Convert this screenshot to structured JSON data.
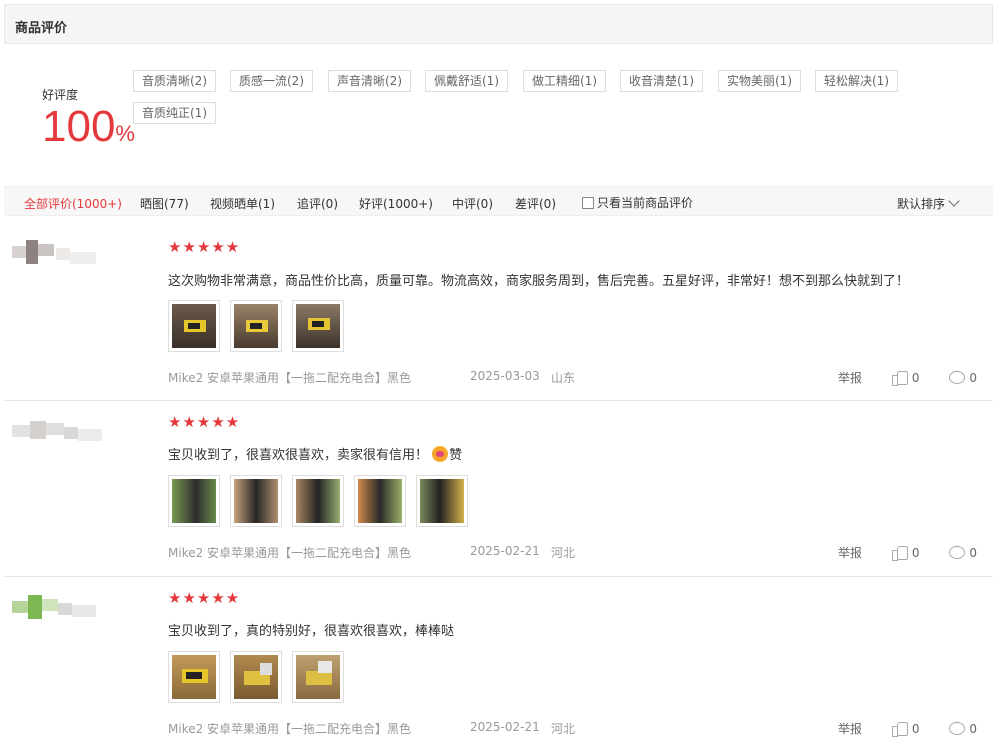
{
  "header": {
    "title": "商品评价"
  },
  "rating": {
    "label": "好评度",
    "value": "100",
    "unit": "%"
  },
  "tags": [
    "音质清晰(2)",
    "质感一流(2)",
    "声音清晰(2)",
    "佩戴舒适(1)",
    "做工精细(1)",
    "收音清楚(1)",
    "实物美丽(1)",
    "轻松解决(1)",
    "音质纯正(1)"
  ],
  "filters": {
    "tabs": [
      "全部评价(1000+)",
      "晒图(77)",
      "视频晒单(1)",
      "追评(0)",
      "好评(1000+)",
      "中评(0)",
      "差评(0)"
    ],
    "only_current": "只看当前商品评价",
    "sort": "默认排序"
  },
  "reviews": [
    {
      "stars": "★★★★★",
      "text": "这次购物非常满意，商品性价比高，质量可靠。物流高效，商家服务周到，售后完善。五星好评，非常好！想不到那么快就到了！",
      "photo_count": 3,
      "product": "Mike2 安卓苹果通用【一拖二配充电合】黑色",
      "date": "2025-03-03",
      "region": "山东",
      "report": "举报",
      "likes": "0",
      "comments": "0"
    },
    {
      "stars": "★★★★★",
      "text": "宝贝收到了，很喜欢很喜欢，卖家很有信用！",
      "text_suffix": "赞",
      "photo_count": 5,
      "product": "Mike2 安卓苹果通用【一拖二配充电合】黑色",
      "date": "2025-02-21",
      "region": "河北",
      "report": "举报",
      "likes": "0",
      "comments": "0"
    },
    {
      "stars": "★★★★★",
      "text": "宝贝收到了，真的特别好，很喜欢很喜欢，棒棒哒",
      "photo_count": 3,
      "product": "Mike2 安卓苹果通用【一拖二配充电合】黑色",
      "date": "2025-02-21",
      "region": "河北",
      "report": "举报",
      "likes": "0",
      "comments": "0"
    }
  ],
  "colors": {
    "accent": "#e4393c"
  }
}
